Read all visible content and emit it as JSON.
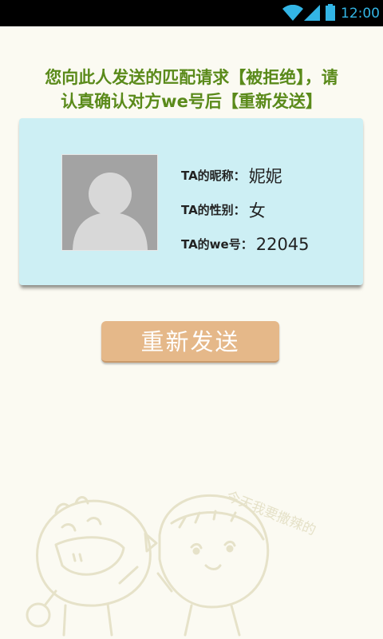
{
  "status_bar": {
    "time": "12:00",
    "icons": [
      "wifi-icon",
      "signal-icon",
      "battery-icon"
    ]
  },
  "notice": {
    "line1": "您向此人发送的匹配请求【被拒绝】，请",
    "line2": "认真确认对方we号后【重新发送】",
    "color": "#5a8a1a"
  },
  "profile": {
    "nickname_label": "TA的昵称：",
    "nickname": "妮妮",
    "gender_label": "TA的性别：",
    "gender": "女",
    "we_id_label": "TA的we号：",
    "we_id": "22045",
    "avatar_icon": "default-avatar-icon",
    "card_color": "#cdeff4"
  },
  "actions": {
    "resend_label": "重新发送",
    "button_color": "#e5b889"
  },
  "decoration": {
    "tagline": "今天我要撒辣的"
  }
}
